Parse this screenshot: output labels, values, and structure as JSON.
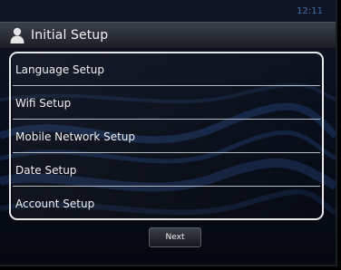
{
  "status": {
    "time": "12:11"
  },
  "header": {
    "title": "Initial Setup",
    "icon": "user-icon"
  },
  "menu": {
    "items": [
      {
        "label": "Language Setup"
      },
      {
        "label": "Wifi Setup"
      },
      {
        "label": "Mobile Network Setup"
      },
      {
        "label": "Date Setup"
      },
      {
        "label": "Account Setup"
      }
    ]
  },
  "footer": {
    "next_label": "Next"
  },
  "colors": {
    "accent_clock": "#3e6ea8",
    "menu_border": "#e8e8e8",
    "background": "#0a0f1c"
  }
}
